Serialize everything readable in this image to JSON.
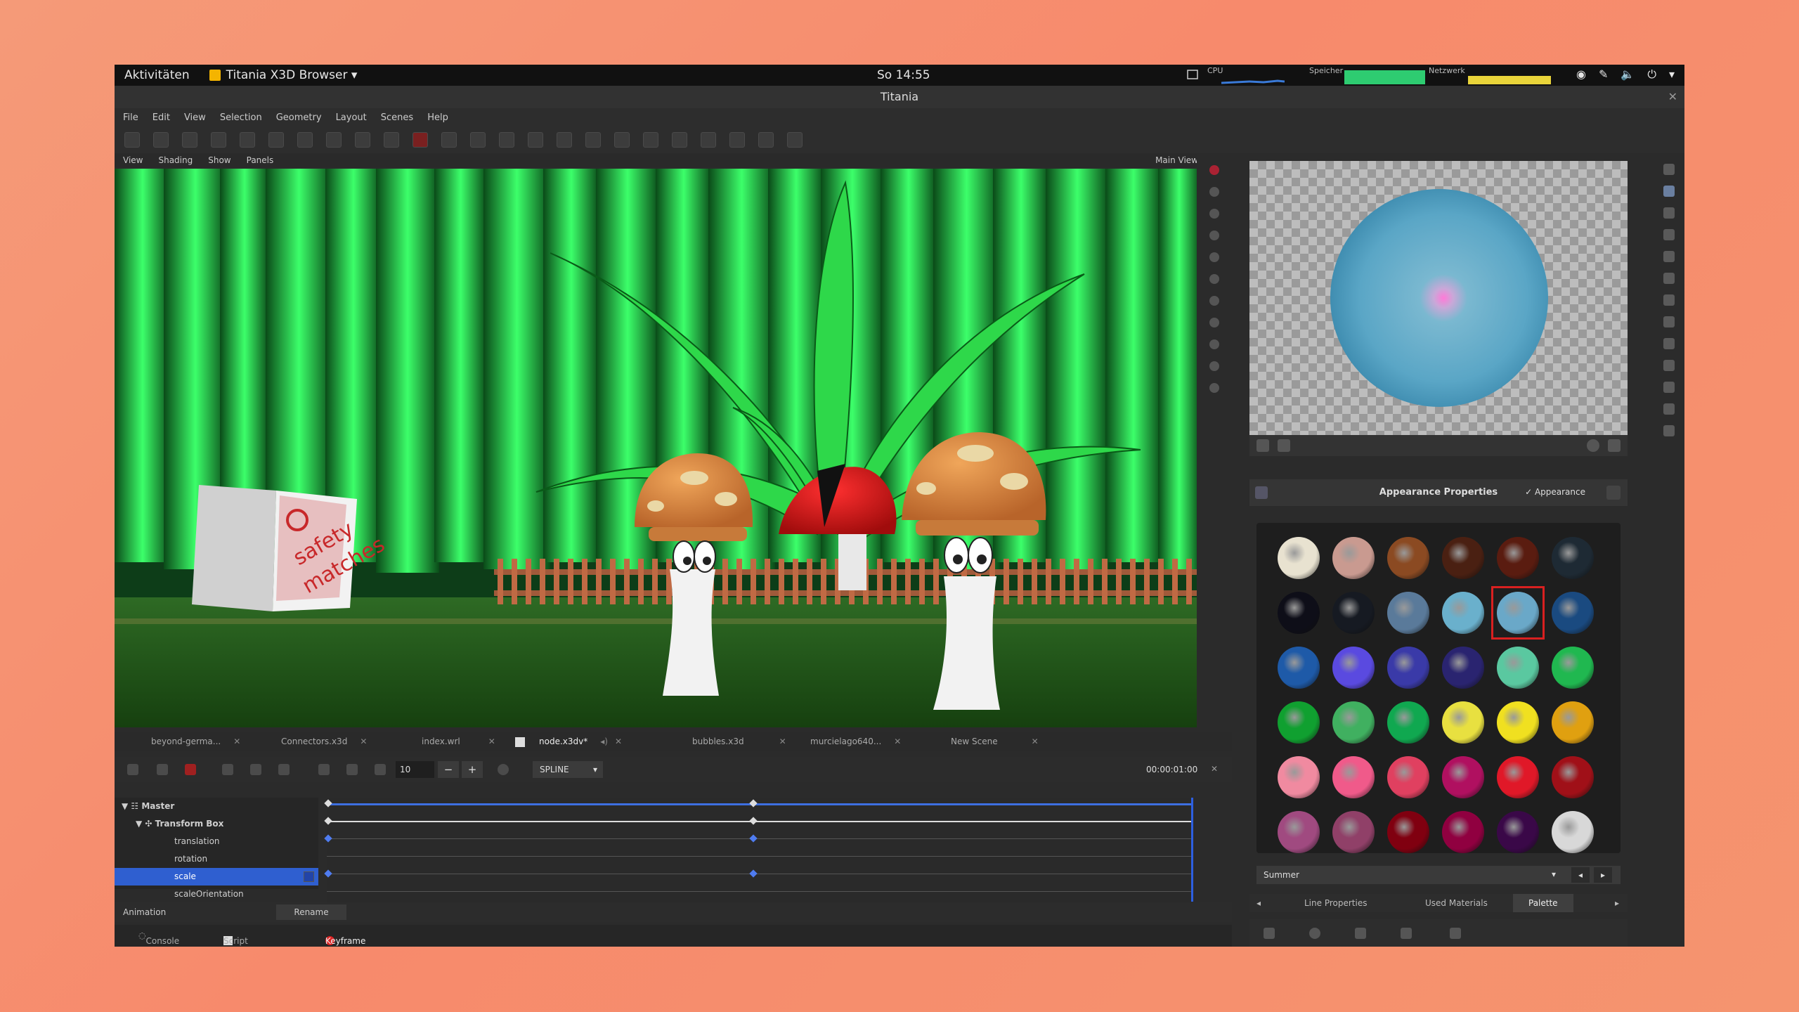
{
  "gnome": {
    "activities": "Aktivitäten",
    "app_name": "Titania X3D Browser ▾",
    "clock": "So 14:55",
    "cpu_label": "CPU",
    "mem_label": "Speicher",
    "net_label": "Netzwerk"
  },
  "window": {
    "title": "Titania"
  },
  "menu": {
    "file": "File",
    "edit": "Edit",
    "view": "View",
    "selection": "Selection",
    "geometry": "Geometry",
    "layout": "Layout",
    "scenes": "Scenes",
    "help": "Help"
  },
  "viewport_menu": {
    "view": "View",
    "shading": "Shading",
    "show": "Show",
    "panels": "Panels",
    "main_view": "Main View"
  },
  "scene": {
    "box_label_top": "safety",
    "box_label_bottom": "matches"
  },
  "file_tabs": [
    {
      "label": "beyond-germa..."
    },
    {
      "label": "Connectors.x3d"
    },
    {
      "label": "index.wrl"
    },
    {
      "label": "node.x3dv*"
    },
    {
      "label": "bubbles.x3d"
    },
    {
      "label": "murcielago640..."
    },
    {
      "label": "New Scene"
    }
  ],
  "animation": {
    "frame_value": "10",
    "interpolation": "SPLINE",
    "time": "00:00:01:00",
    "tree": [
      {
        "label": "Master"
      },
      {
        "label": "Transform Box"
      },
      {
        "label": "translation"
      },
      {
        "label": "rotation"
      },
      {
        "label": "scale"
      },
      {
        "label": "scaleOrientation"
      }
    ],
    "footer_label": "Animation",
    "rename": "Rename",
    "progress_fraction": 1.0
  },
  "dock": {
    "console": "Console",
    "script_editor": "Script Editor",
    "keyframe_animation": "Keyframe Animation"
  },
  "appearance": {
    "title": "Appearance Properties",
    "checkbox_label": "✓ Appearance",
    "palette_name": "Summer",
    "tabs": {
      "line": "Line Properties",
      "used": "Used Materials",
      "palette": "Palette"
    },
    "selected_index": 10,
    "colors": [
      "#e8e2d0",
      "#c99a90",
      "#8b4a22",
      "#4a2012",
      "#5a1c10",
      "#1e2a34",
      "#0e0e18",
      "#161a22",
      "#5a7a9a",
      "#6ab0cc",
      "#6aa8c8",
      "#1a4a80",
      "#1e5aa8",
      "#5a4ae0",
      "#3a3aa8",
      "#2a2470",
      "#5ac8a0",
      "#20b850",
      "#10a030",
      "#40b060",
      "#10a850",
      "#e8e040",
      "#f0e020",
      "#e0a010",
      "#f08aa0",
      "#f05a8a",
      "#e04060",
      "#b01060",
      "#e01828",
      "#a01018",
      "#a04a80",
      "#904068",
      "#800010",
      "#900040",
      "#3a0848",
      "#d8d8d8"
    ]
  }
}
